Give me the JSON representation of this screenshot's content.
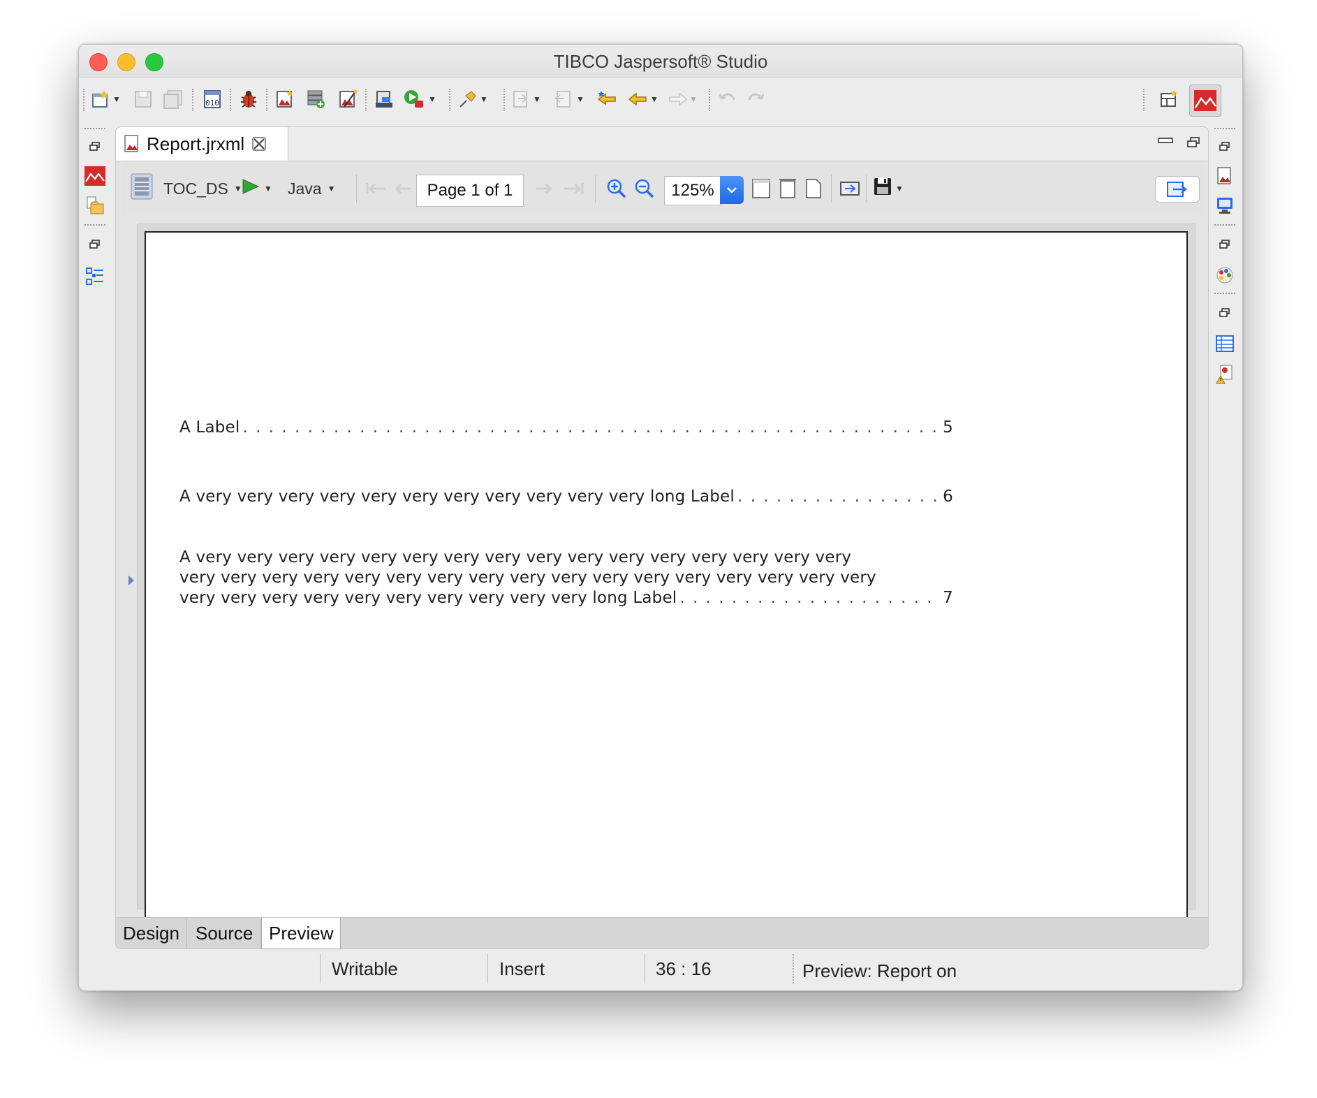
{
  "window": {
    "title": "TIBCO Jaspersoft® Studio"
  },
  "main_toolbar": {
    "icons": [
      "new-icon",
      "save-icon",
      "save-all-icon",
      "compile-icon",
      "debug-bug-icon",
      "new-report-icon",
      "new-dataset-icon",
      "wizard-icon",
      "publish-icon",
      "run-icon",
      "pin-icon",
      "import-icon",
      "export-icon",
      "last-edit-icon",
      "back-icon",
      "forward-icon",
      "undo-icon",
      "redo-icon",
      "open-perspective-icon",
      "report-design-perspective-icon"
    ]
  },
  "editor": {
    "tab_label": "Report.jrxml",
    "preview_toolbar": {
      "datasource": "TOC_DS",
      "language": "Java",
      "page_indicator": "Page 1 of 1",
      "zoom": "125%"
    },
    "toc": [
      {
        "label": "A Label",
        "page": "5"
      },
      {
        "label": "A very very very very very very very very very very very long Label",
        "page": "6"
      },
      {
        "lines": [
          "A very very very very very very very very very very very very very very very very",
          "very very very very very very very very very very very very very very very very very"
        ],
        "last_line": "very very very very very very very very very very long Label",
        "page": "7"
      }
    ],
    "bottom_tabs": [
      "Design",
      "Source",
      "Preview"
    ],
    "active_bottom_tab": "Preview"
  },
  "status_bar": {
    "mode": "Writable",
    "insert": "Insert",
    "position": "36 : 16",
    "message": "Preview: Report on"
  },
  "colors": {
    "accent_blue": "#2b6de8",
    "jasper_red": "#d42b2b",
    "run_green": "#36a336"
  }
}
